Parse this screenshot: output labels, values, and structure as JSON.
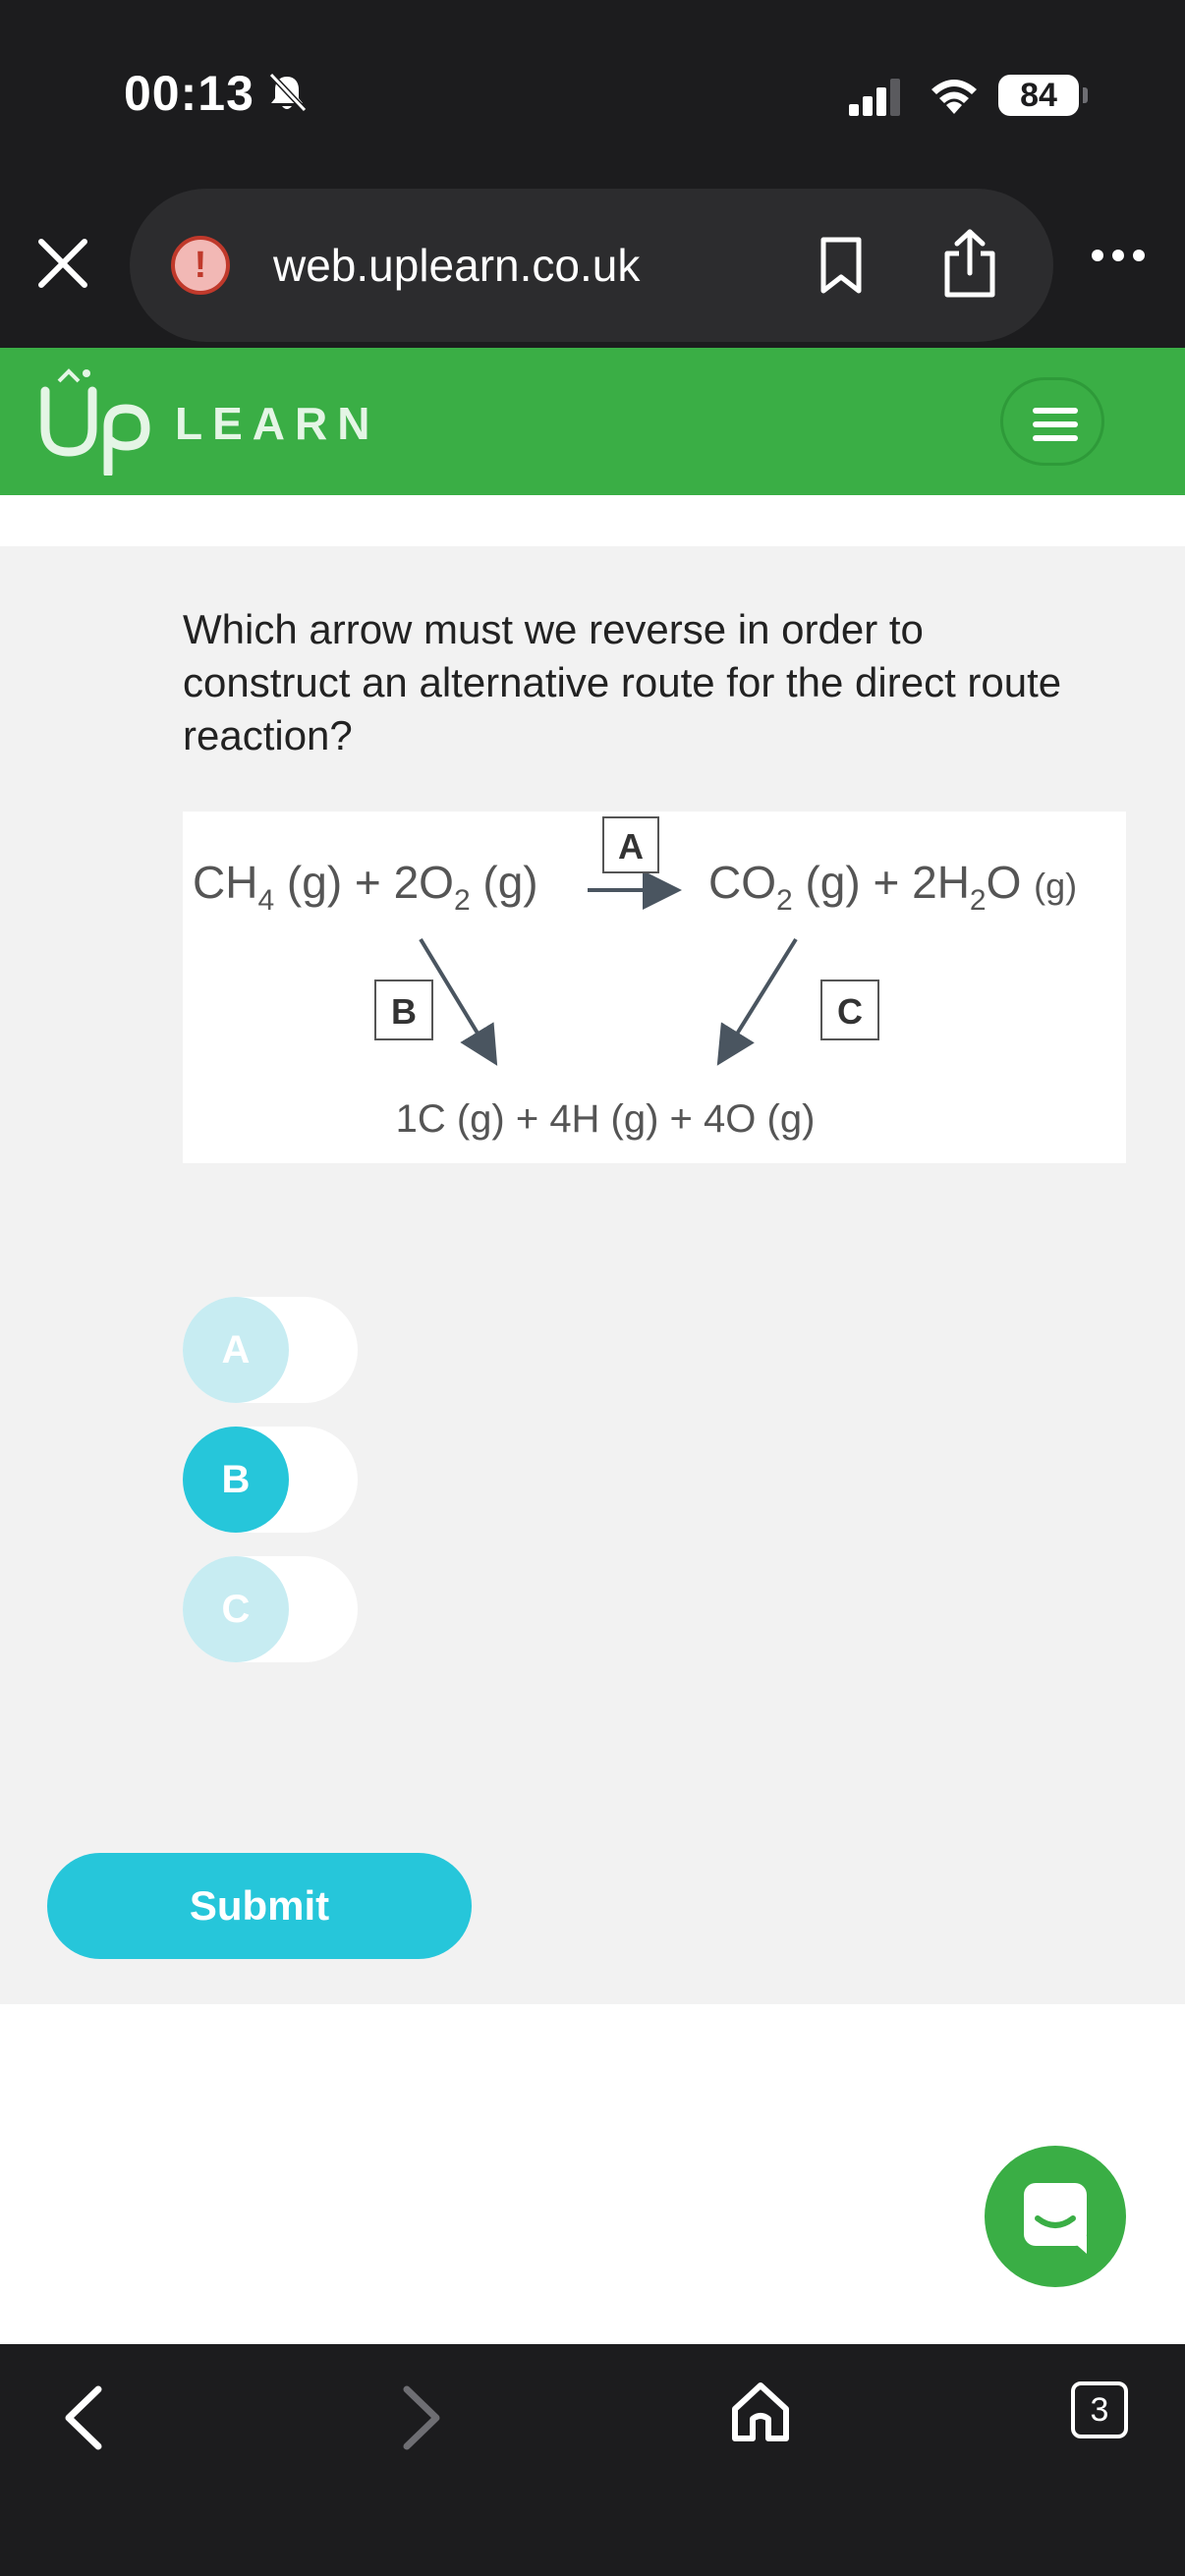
{
  "status_bar": {
    "time": "00:13",
    "battery": "84"
  },
  "browser": {
    "url": "web.uplearn.co.uk",
    "alert_symbol": "!",
    "icons": [
      "close-icon",
      "alert-icon",
      "bookmark-icon",
      "share-icon",
      "more-icon"
    ]
  },
  "app_header": {
    "logo_text": "LEARN",
    "menu_icon": "hamburger-icon",
    "brand_color": "#3aae45"
  },
  "question": {
    "text": "Which arrow must we reverse in order to construct an alternative route for the direct route reaction?"
  },
  "diagram": {
    "left_side": "CH4 (g) + 2O2 (g)",
    "right_side": "CO2 (g) + 2H2O (g)",
    "bottom": "1C (g) + 4H (g) + 4O (g)",
    "labels": {
      "a": "A",
      "b": "B",
      "c": "C"
    }
  },
  "options": [
    {
      "label": "A",
      "selected": false
    },
    {
      "label": "B",
      "selected": true
    },
    {
      "label": "C",
      "selected": false
    }
  ],
  "submit_label": "Submit",
  "accent_color": "#26c6da",
  "bottom_nav": {
    "tabs_count": "3",
    "icons": [
      "back-icon",
      "forward-icon",
      "home-icon",
      "tabs-icon"
    ]
  }
}
